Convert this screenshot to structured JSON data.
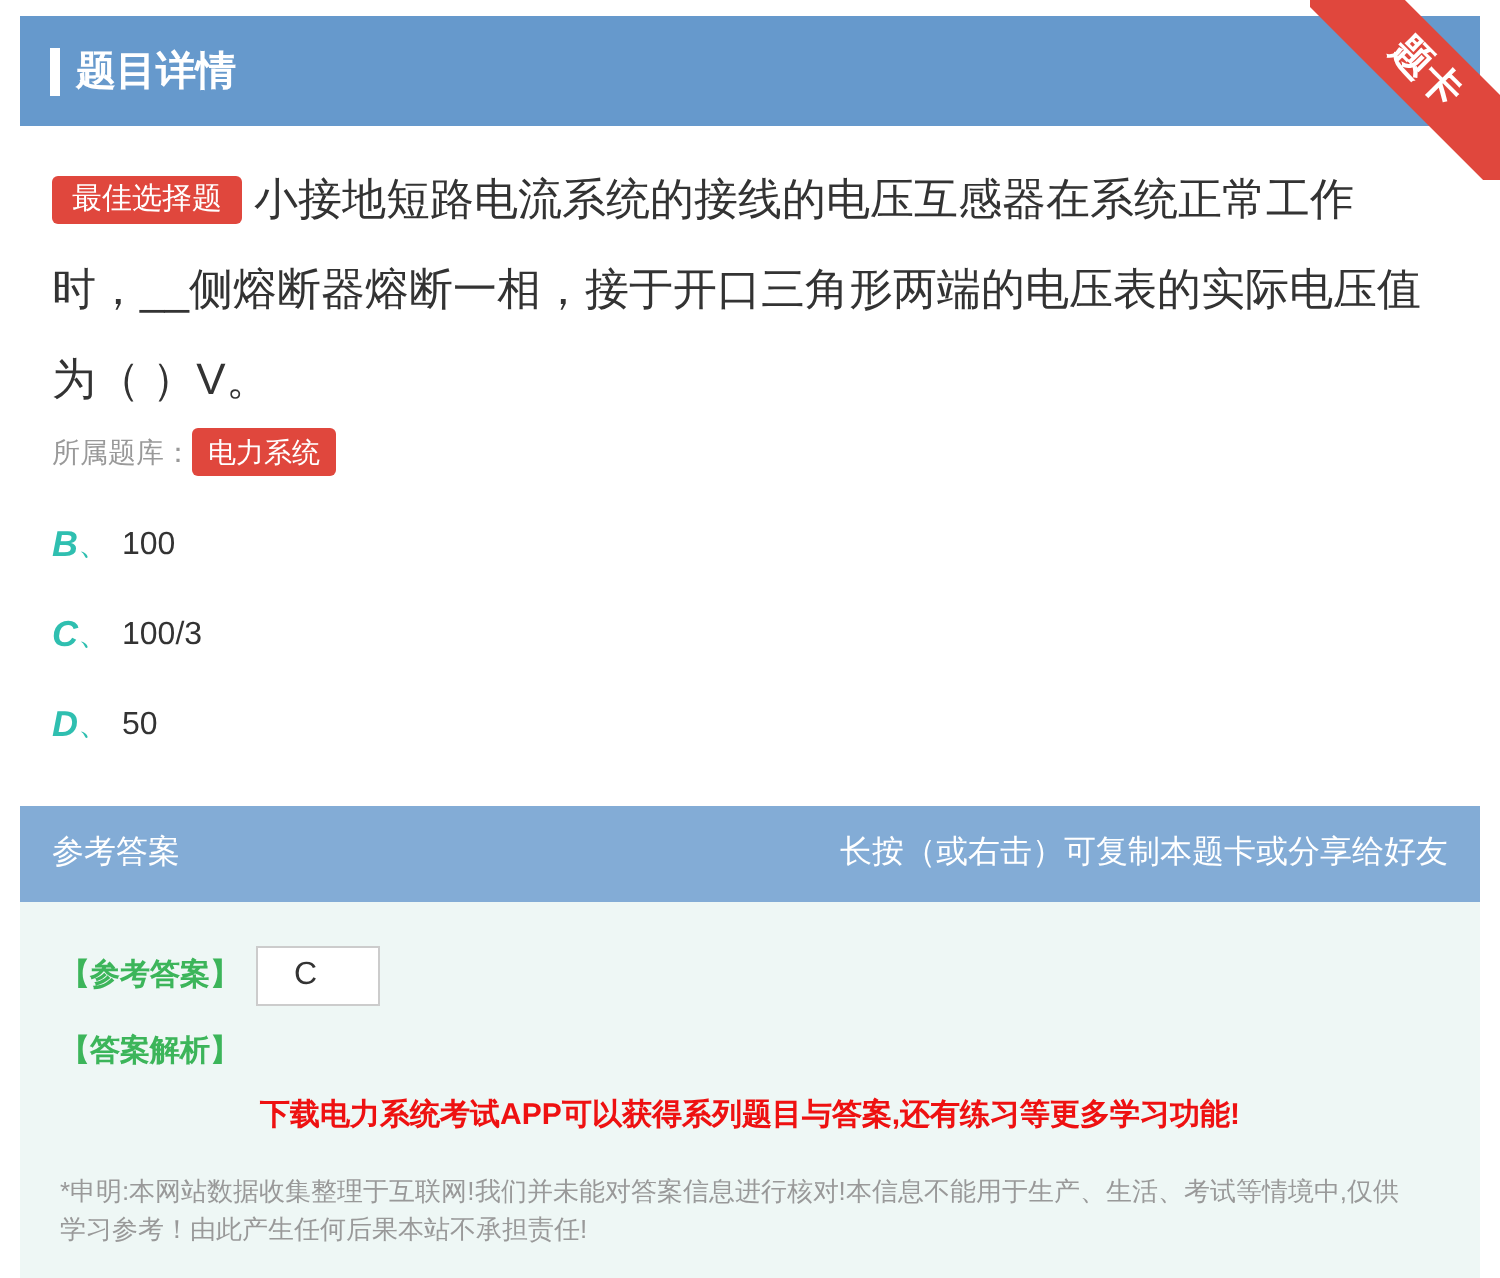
{
  "header": {
    "title": "题目详情",
    "ribbon": "题卡"
  },
  "question": {
    "tag": "最佳选择题",
    "text": "小接地短路电流系统的接线的电压互感器在系统正常工作时，__侧熔断器熔断一相，接于开口三角形两端的电压表的实际电压值为（ ）V。",
    "bank_label": "所属题库：",
    "bank": "电力系统"
  },
  "options": [
    {
      "letter": "B",
      "sep": "、",
      "text": "100"
    },
    {
      "letter": "C",
      "sep": "、",
      "text": "100/3"
    },
    {
      "letter": "D",
      "sep": "、",
      "text": "50"
    }
  ],
  "answer_section": {
    "title": "参考答案",
    "hint": "长按（或右击）可复制本题卡或分享给好友",
    "answer_label": "【参考答案】",
    "answer": "C",
    "analysis_label": "【答案解析】",
    "promo": "下载电力系统考试APP可以获得系列题目与答案,还有练习等更多学习功能!",
    "disclaimer": "*申明:本网站数据收集整理于互联网!我们并未能对答案信息进行核对!本信息不能用于生产、生活、考试等情境中,仅供学习参考！由此产生任何后果本站不承担责任!"
  }
}
